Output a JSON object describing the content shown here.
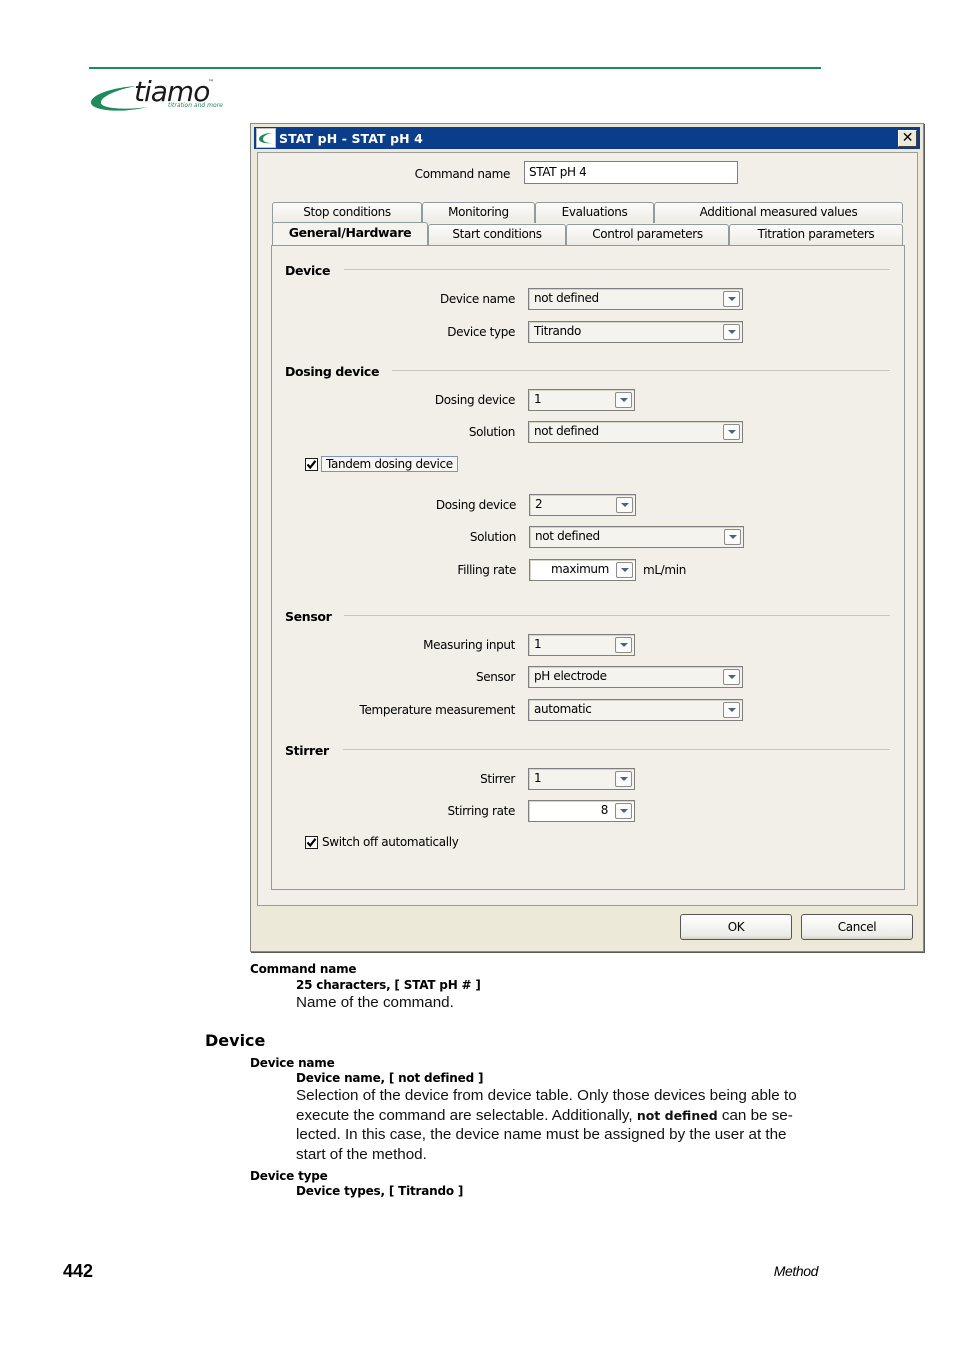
{
  "brand": {
    "logo_text": "tiamo",
    "trademark": "™",
    "tagline": "titration and more",
    "accent_color": "#1f8a5c"
  },
  "dialog": {
    "title": "STAT pH - STAT pH 4",
    "title_bar_color": "#0a3d8a",
    "close_label": "✕",
    "command_name_label": "Command name",
    "command_name_value": "STAT pH 4",
    "tabs_back_row": [
      {
        "label": "Stop conditions"
      },
      {
        "label": "Monitoring"
      },
      {
        "label": "Evaluations"
      },
      {
        "label": "Additional measured values"
      }
    ],
    "tabs_front_row": [
      {
        "label": "General/Hardware",
        "active": true
      },
      {
        "label": "Start conditions"
      },
      {
        "label": "Control parameters"
      },
      {
        "label": "Titration parameters"
      }
    ],
    "sections": {
      "device": {
        "title": "Device",
        "device_name_label": "Device name",
        "device_name_value": "not defined",
        "device_type_label": "Device type",
        "device_type_value": "Titrando"
      },
      "dosing": {
        "title": "Dosing device",
        "dosing_device_label": "Dosing device",
        "dosing_device_value": "1",
        "solution_label": "Solution",
        "solution_value": "not defined",
        "tandem_label": "Tandem dosing device",
        "tandem_checked": true,
        "dosing_device2_label": "Dosing device",
        "dosing_device2_value": "2",
        "solution2_label": "Solution",
        "solution2_value": "not defined",
        "filling_rate_label": "Filling rate",
        "filling_rate_value": "maximum",
        "filling_rate_unit": "mL/min"
      },
      "sensor": {
        "title": "Sensor",
        "measuring_input_label": "Measuring input",
        "measuring_input_value": "1",
        "sensor_label": "Sensor",
        "sensor_value": "pH electrode",
        "temperature_label": "Temperature measurement",
        "temperature_value": "automatic"
      },
      "stirrer": {
        "title": "Stirrer",
        "stirrer_label": "Stirrer",
        "stirrer_value": "1",
        "stirring_rate_label": "Stirring rate",
        "stirring_rate_value": "8",
        "switch_off_label": "Switch off automatically",
        "switch_off_checked": true
      }
    },
    "ok_label": "OK",
    "cancel_label": "Cancel"
  },
  "doc": {
    "command_name": {
      "term": "Command name",
      "spec": "25 characters, [ STAT pH # ]",
      "desc": "Name of the command."
    },
    "device_heading": "Device",
    "device_name": {
      "term": "Device name",
      "spec": "Device name, [ not defined ]",
      "desc_lines": [
        "Selection of the device from device table. Only those devices being able to",
        "execute the command are selectable. Additionally,",
        "not defined",
        " can be se-",
        "lected. In this case, the device name must be assigned by the user at the",
        "start of the method."
      ]
    },
    "device_type": {
      "term": "Device type",
      "spec": "Device types, [ Titrando ]"
    }
  },
  "footer": {
    "page_number": "442",
    "section": "Method"
  }
}
